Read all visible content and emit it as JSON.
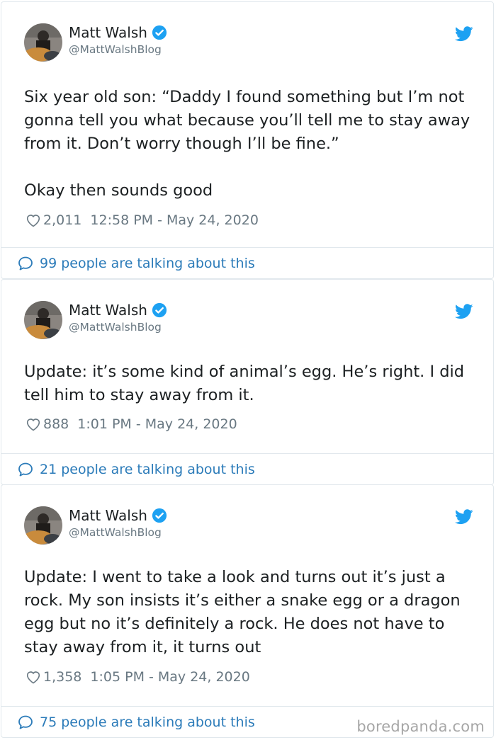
{
  "tweets": [
    {
      "author_name": "Matt Walsh",
      "handle": "@MattWalshBlog",
      "text": "Six year old son: “Daddy I found something but I’m not gonna tell you what because you’ll tell me to stay away from it. Don’t worry though I’ll be fine.”\n\nOkay then sounds good",
      "likes": "2,011",
      "timestamp": "12:58 PM - May 24, 2020",
      "talking": "99 people are talking about this"
    },
    {
      "author_name": "Matt Walsh",
      "handle": "@MattWalshBlog",
      "text": "Update: it’s some kind of animal’s egg. He’s right. I did tell him to stay away from it.",
      "likes": "888",
      "timestamp": "1:01 PM - May 24, 2020",
      "talking": "21 people are talking about this"
    },
    {
      "author_name": "Matt Walsh",
      "handle": "@MattWalshBlog",
      "text": "Update: I went to take a look and turns out it’s just a rock. My son insists it’s either a snake egg or a dragon egg but no it’s definitely a rock. He does not have to stay away from it, it turns out",
      "likes": "1,358",
      "timestamp": "1:05 PM - May 24, 2020",
      "talking": "75 people are talking about this"
    }
  ],
  "icons": {
    "verified": "verified-badge-icon",
    "bird": "twitter-bird-icon",
    "heart": "heart-icon",
    "bubble": "speech-bubble-icon"
  },
  "colors": {
    "link_blue": "#2b7bb9",
    "twitter_blue": "#1da1f2",
    "muted_gray": "#697882",
    "border": "#e1e8ed"
  },
  "watermark": "boredpanda.com"
}
